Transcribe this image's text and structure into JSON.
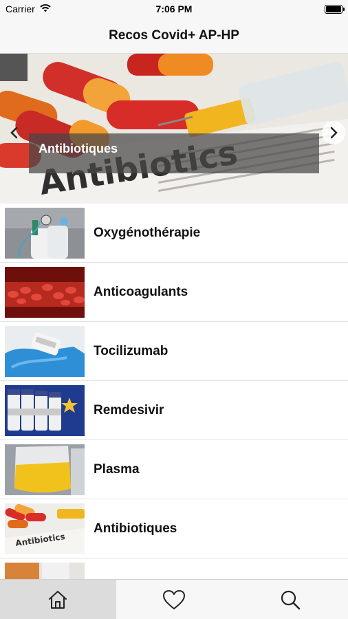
{
  "status_bar": {
    "carrier": "Carrier",
    "time": "7:06 PM"
  },
  "nav": {
    "title": "Recos Covid+ AP-HP"
  },
  "carousel": {
    "caption": "Antibiotiques",
    "banner_text": "Antibiotics"
  },
  "items": [
    {
      "label": "Oxygénothérapie",
      "thumb": "oxygen-equipment"
    },
    {
      "label": "Anticoagulants",
      "thumb": "blood-cells"
    },
    {
      "label": "Tocilizumab",
      "thumb": "gloved-hand-vial"
    },
    {
      "label": "Remdesivir",
      "thumb": "vials"
    },
    {
      "label": "Plasma",
      "thumb": "plasma-bag"
    },
    {
      "label": "Antibiotiques",
      "thumb": "antibiotic-pills"
    },
    {
      "label": "",
      "thumb": "partial-next-item"
    }
  ],
  "tab_bar": {
    "tabs": [
      {
        "name": "home",
        "icon": "home-icon",
        "active": true
      },
      {
        "name": "favorites",
        "icon": "heart-icon",
        "active": false
      },
      {
        "name": "search",
        "icon": "search-icon",
        "active": false
      }
    ]
  },
  "colors": {
    "tab_active_bg": "#dcdcdc",
    "bar_bg": "#f7f7f7",
    "caption_overlay": "#464646"
  }
}
